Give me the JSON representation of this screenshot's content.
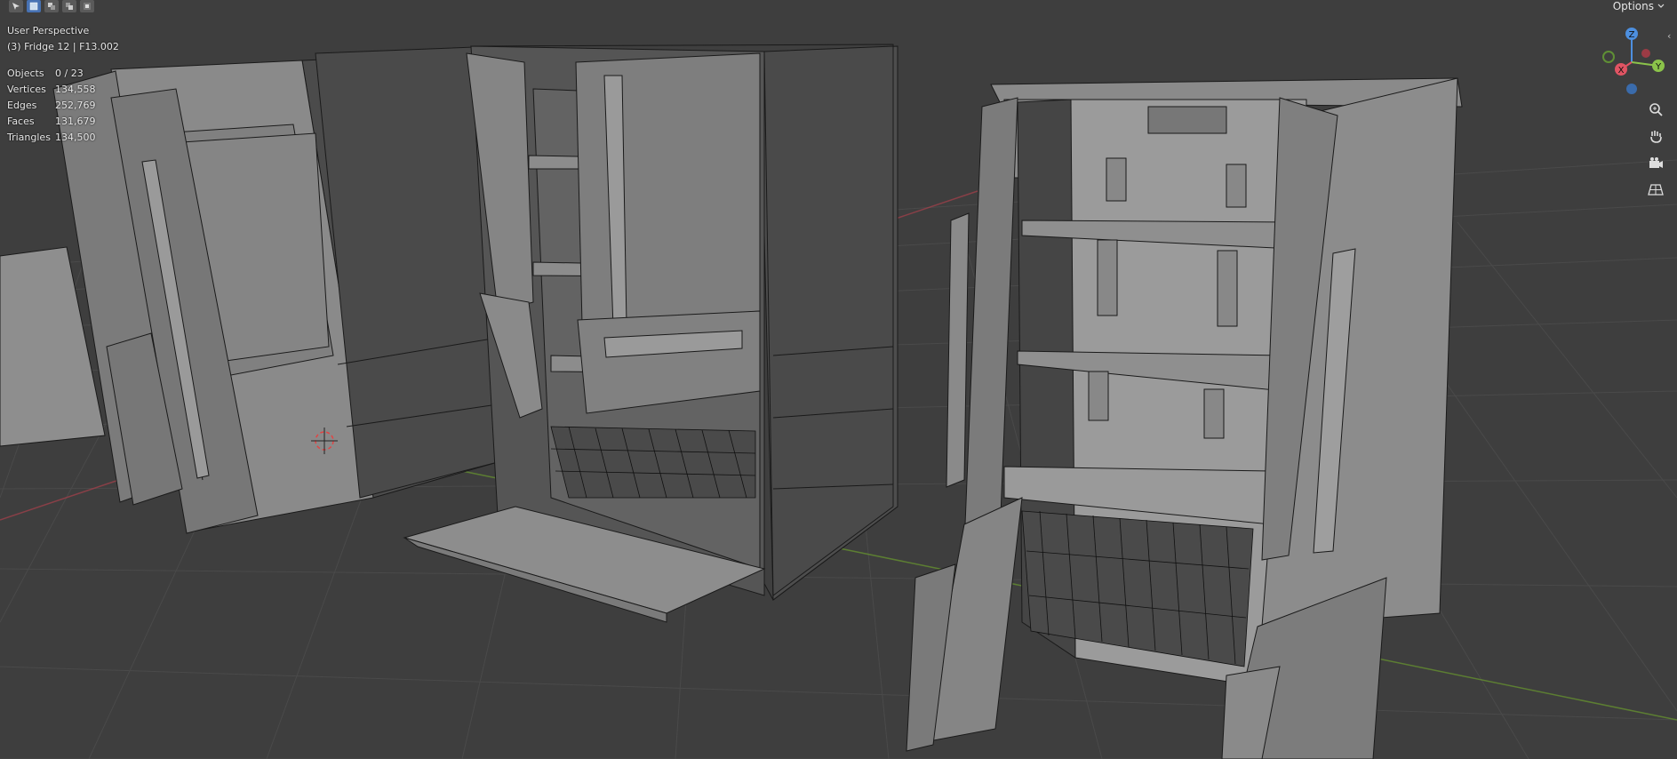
{
  "viewport": {
    "view_name": "User Perspective",
    "active_object": "(3) Fridge 12 | F13.002"
  },
  "stats": [
    {
      "label": "Objects",
      "value": "0 / 23"
    },
    {
      "label": "Vertices",
      "value": "134,558"
    },
    {
      "label": "Edges",
      "value": "252,769"
    },
    {
      "label": "Faces",
      "value": "131,679"
    },
    {
      "label": "Triangles",
      "value": "134,500"
    }
  ],
  "header": {
    "options_label": "Options"
  },
  "gizmo": {
    "axes": [
      "Z",
      "Y",
      "X"
    ],
    "colors": {
      "x": "#e05463",
      "y": "#8bc34a",
      "z": "#4d8fdf",
      "x_neg": "#9c3b45",
      "y_neg": "#5f8f35",
      "z_neg": "#3a6bab"
    }
  },
  "nav_buttons": [
    "zoom-icon",
    "hand-pan-icon",
    "camera-icon",
    "grid-perspective-icon"
  ],
  "colors": {
    "background": "#3e3e3e",
    "grid": "#4a4a4a",
    "x_axis_line": "#a8404b",
    "y_axis_line": "#6a9a2e",
    "model_light": "#8f8f8f",
    "model_mid": "#7a7a7a",
    "model_dark": "#4e4e4e",
    "wire": "#1a1a1a"
  }
}
